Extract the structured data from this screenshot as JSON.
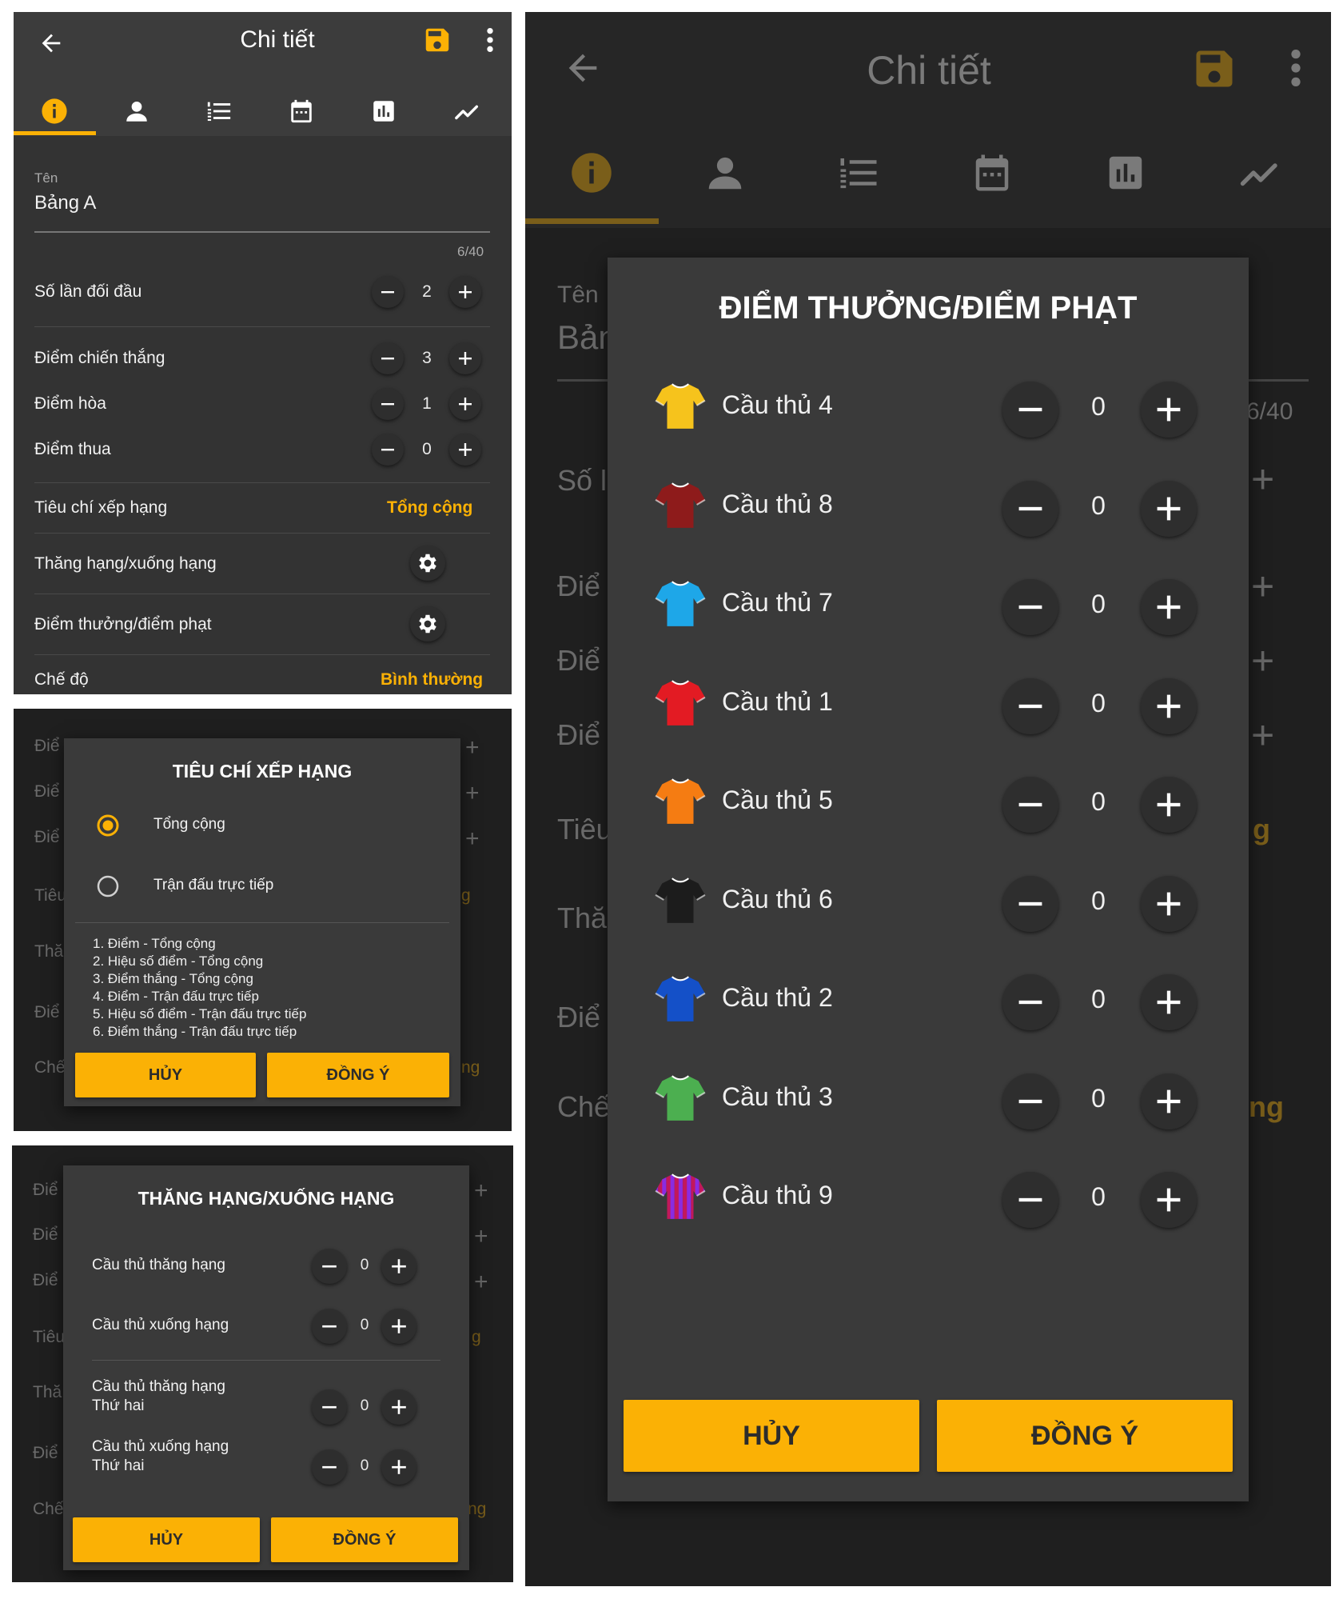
{
  "colors": {
    "accent": "#fbb105",
    "background": "#333333",
    "appbar": "#3c3c3c",
    "dialog": "#3a3a3a"
  },
  "appbar": {
    "title": "Chi tiết",
    "icons": [
      "back-arrow-icon",
      "save-icon",
      "more-vert-icon"
    ]
  },
  "tabs": [
    "info-icon",
    "person-icon",
    "numbered-list-icon",
    "calendar-icon",
    "bar-chart-icon",
    "trend-icon"
  ],
  "details": {
    "name_label": "Tên",
    "name_value": "Bảng A",
    "counter": "6/40",
    "rows": [
      {
        "label": "Số lần đối đầu",
        "value": "2"
      },
      {
        "label": "Điểm chiến thắng",
        "value": "3"
      },
      {
        "label": "Điểm hòa",
        "value": "1"
      },
      {
        "label": "Điểm thua",
        "value": "0"
      }
    ],
    "ranking_label": "Tiêu chí xếp hạng",
    "ranking_value": "Tổng cộng",
    "promotion_label": "Thăng hạng/xuống hạng",
    "bonus_label": "Điểm thưởng/điểm phạt",
    "mode_label": "Chế độ",
    "mode_value": "Bình thường"
  },
  "bg_fragments": {
    "diem": "Điể",
    "tieu": "Tiêu",
    "tha": "Thă",
    "che": "Chế",
    "so": "Số l",
    "ban": "Bản",
    "g": "g",
    "ng": "ng"
  },
  "ranking_dialog": {
    "title": "TIÊU CHÍ XẾP HẠNG",
    "options": [
      {
        "label": "Tổng cộng",
        "selected": true
      },
      {
        "label": "Trận đấu trực tiếp",
        "selected": false
      }
    ],
    "criteria": [
      "1. Điểm - Tổng cộng",
      "2. Hiệu số điểm - Tổng cộng",
      "3. Điểm thắng - Tổng cộng",
      "4. Điểm - Trận đấu trực tiếp",
      "5. Hiệu số điểm - Trận đấu trực tiếp",
      "6. Điểm thắng - Trận đấu trực tiếp"
    ],
    "cancel": "HỦY",
    "ok": "ĐỒNG Ý"
  },
  "promotion_dialog": {
    "title": "THĂNG HẠNG/XUỐNG HẠNG",
    "rows": [
      {
        "label": "Cầu thủ thăng hạng",
        "value": "0"
      },
      {
        "label": "Cầu thủ xuống hạng",
        "value": "0"
      },
      {
        "label": "Cầu thủ thăng hạng",
        "sub": "Thứ hai",
        "value": "0"
      },
      {
        "label": "Cầu thủ xuống hạng",
        "sub": "Thứ hai",
        "value": "0"
      }
    ],
    "cancel": "HỦY",
    "ok": "ĐỒNG Ý"
  },
  "bonus_dialog": {
    "title": "ĐIỂM THƯỞNG/ĐIỂM PHẠT",
    "players": [
      {
        "name": "Cầu thủ 4",
        "value": "0",
        "shirt": "#f6c31c"
      },
      {
        "name": "Cầu thủ 8",
        "value": "0",
        "shirt": "#8e1b1b"
      },
      {
        "name": "Cầu thủ 7",
        "value": "0",
        "shirt": "#1ea7e8"
      },
      {
        "name": "Cầu thủ 1",
        "value": "0",
        "shirt": "#e31b23"
      },
      {
        "name": "Cầu thủ 5",
        "value": "0",
        "shirt": "#f57c12"
      },
      {
        "name": "Cầu thủ 6",
        "value": "0",
        "shirt": "#1c1c1c"
      },
      {
        "name": "Cầu thủ 2",
        "value": "0",
        "shirt": "#1450c8"
      },
      {
        "name": "Cầu thủ 3",
        "value": "0",
        "shirt": "#4caf50"
      },
      {
        "name": "Cầu thủ 9",
        "value": "0",
        "shirt": "#8a2be2"
      }
    ],
    "cancel": "HỦY",
    "ok": "ĐỒNG Ý"
  },
  "large_bg": {
    "counter": "6/40"
  }
}
